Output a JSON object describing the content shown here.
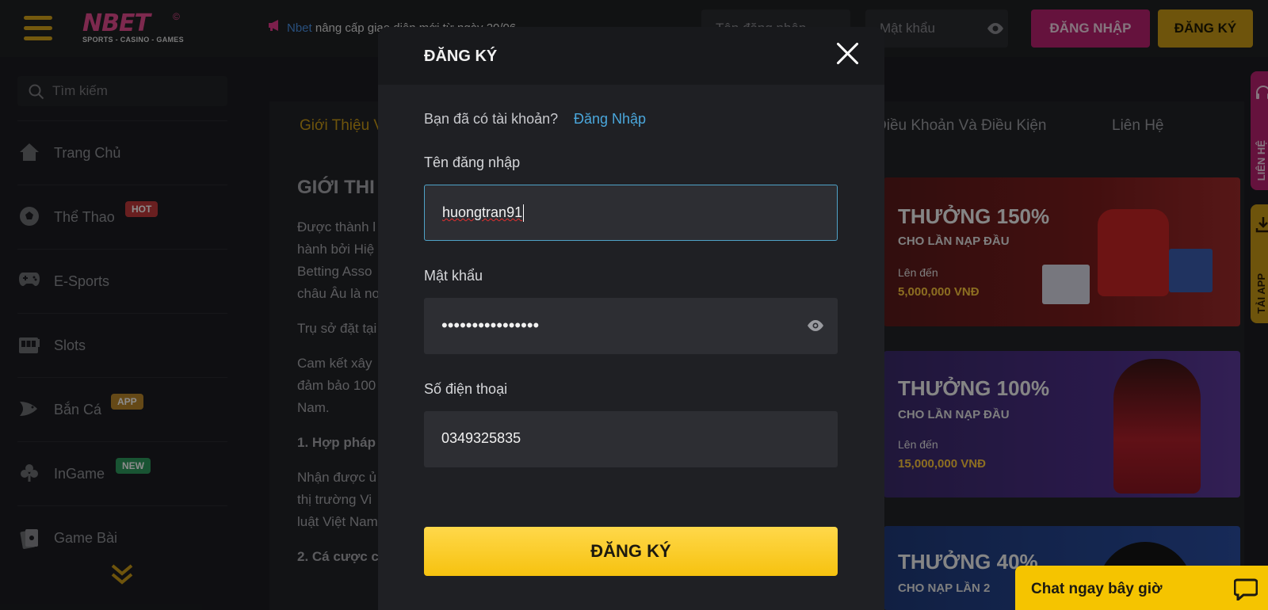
{
  "header": {
    "logo_text": "NBET",
    "logo_reg": "©",
    "logo_tagline": "SPORTS - CASINO - GAMES",
    "marquee_brand": "Nbet",
    "marquee_text": "nâng cấp giao diện mới từ ngày 20/06",
    "username_placeholder": "Tên đăng nhập",
    "password_placeholder": "Mật khẩu",
    "login_button": "ĐĂNG NHẬP",
    "register_button": "ĐĂNG KÝ"
  },
  "sidebar": {
    "search_placeholder": "Tìm kiếm",
    "items": [
      {
        "label": "Trang Chủ",
        "icon": "home-icon"
      },
      {
        "label": "Thể Thao",
        "icon": "soccer-ball-icon",
        "badge": "HOT"
      },
      {
        "label": "E-Sports",
        "icon": "gamepad-icon"
      },
      {
        "label": "Slots",
        "icon": "slot-machine-icon"
      },
      {
        "label": "Bắn Cá",
        "icon": "fish-icon",
        "badge": "APP"
      },
      {
        "label": "InGame",
        "icon": "club-icon",
        "badge": "NEW"
      },
      {
        "label": "Game Bài",
        "icon": "cards-icon"
      }
    ]
  },
  "main": {
    "tabs": [
      "Giới Thiệu V",
      "Điều Khoản Và Điều Kiện",
      "Liên Hệ"
    ],
    "article_title": "GIỚI THI",
    "article_p1": [
      "Được thành l",
      "hành bởi Hiệ",
      "Betting Asso",
      "châu Âu là nơ"
    ],
    "article_p2": "Trụ sở đặt tại",
    "article_p3": [
      "Cam kết xây",
      "đảm bảo 100",
      "Nam."
    ],
    "article_h1": "1. Hợp pháp",
    "article_p4": [
      "Nhận được ủ",
      "thị trường Vi",
      "luật Việt Nam"
    ],
    "article_h2": "2. Cá cược c"
  },
  "banners": [
    {
      "title": "THƯỞNG 150%",
      "subtitle": "CHO LẦN NẠP ĐẦU",
      "upto": "Lên đến",
      "amount": "5,000,000 VNĐ"
    },
    {
      "title": "THƯỞNG 100%",
      "subtitle": "CHO LẦN NẠP ĐẦU",
      "upto": "Lên đến",
      "amount": "15,000,000 VNĐ"
    },
    {
      "title": "THƯỞNG 40%",
      "subtitle": "CHO NẠP LẦN 2"
    }
  ],
  "rail": {
    "contact": "LIÊN HỆ",
    "app": "TẢI APP"
  },
  "modal": {
    "title": "ĐĂNG KÝ",
    "have_account": "Bạn đã có tài khoản?",
    "login_link": "Đăng Nhập",
    "username_label": "Tên đăng nhập",
    "username_value": "huongtran91",
    "password_label": "Mật khẩu",
    "password_value": "••••••••••••••••",
    "phone_label": "Số điện thoại",
    "phone_value": "0349325835",
    "submit": "ĐĂNG KÝ"
  },
  "chat": {
    "label": "Chat ngay bây giờ"
  },
  "colors": {
    "accent_gold": "#f6c20f",
    "accent_pink": "#b8226f",
    "link_blue": "#4aa7dc",
    "background": "#1c1d21"
  }
}
